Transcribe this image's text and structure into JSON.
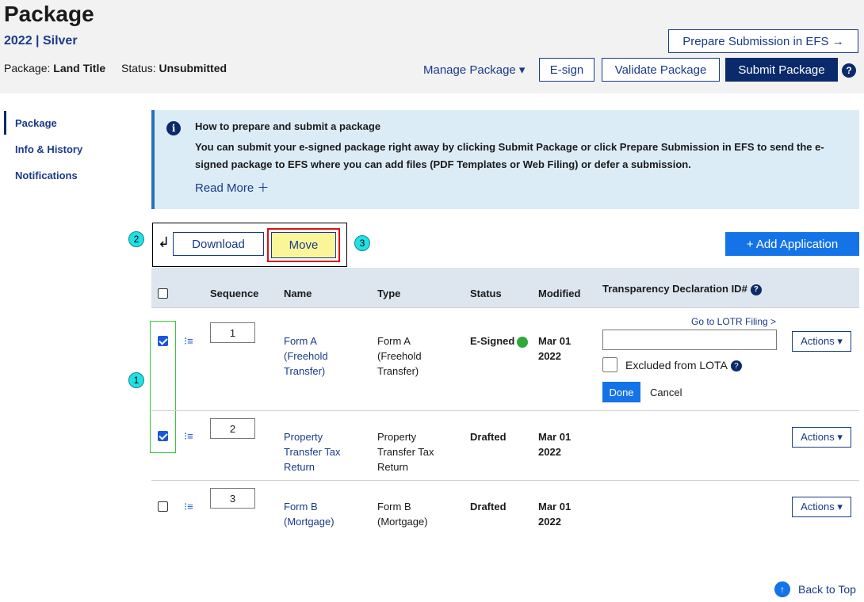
{
  "header": {
    "title": "Package",
    "subtitle": "2022 | Silver",
    "package_label": "Package:",
    "package_value": "Land Title",
    "status_label": "Status:",
    "status_value": "Unsubmitted",
    "prepare_efs": "Prepare Submission in EFS →",
    "manage_package": "Manage Package ▾",
    "esign": "E-sign",
    "validate": "Validate Package",
    "submit": "Submit Package",
    "help": "?"
  },
  "sidebar": {
    "items": [
      {
        "label": "Package",
        "active": true
      },
      {
        "label": "Info & History"
      },
      {
        "label": "Notifications"
      }
    ]
  },
  "info": {
    "icon": "i",
    "title": "How to prepare and submit a package",
    "body": "You can submit your e-signed package right away by clicking Submit Package or click Prepare Submission in EFS to send the e-signed package to EFS where you can add files (PDF Templates or Web Filing) or defer a submission.",
    "read_more": "Read More ＋"
  },
  "toolbar": {
    "download": "Download",
    "move": "Move",
    "add_application": "+ Add Application",
    "bulk_arrow": "↲"
  },
  "callouts": [
    "1",
    "2",
    "3"
  ],
  "table": {
    "headers": {
      "sequence": "Sequence",
      "name": "Name",
      "type": "Type",
      "status": "Status",
      "modified": "Modified",
      "tdid": "Transparency Declaration ID#",
      "tdid_help": "?"
    },
    "rows": [
      {
        "checked": true,
        "sequence": "1",
        "name": [
          "Form A",
          "(Freehold",
          "Transfer)"
        ],
        "type": [
          "Form A",
          "(Freehold",
          "Transfer)"
        ],
        "status": "E-Signed",
        "status_dot": "#2eaa3a",
        "modified": [
          "Mar 01",
          "2022"
        ],
        "actions": "Actions ▾"
      },
      {
        "checked": true,
        "sequence": "2",
        "name": [
          "Property",
          "Transfer Tax",
          "Return"
        ],
        "type": [
          "Property",
          "Transfer Tax",
          "Return"
        ],
        "status": "Drafted",
        "modified": [
          "Mar 01",
          "2022"
        ],
        "actions": "Actions ▾"
      },
      {
        "checked": false,
        "sequence": "3",
        "name": [
          "Form B",
          "(Mortgage)"
        ],
        "type": [
          "Form B",
          "(Mortgage)"
        ],
        "status": "Drafted",
        "modified": [
          "Mar 01",
          "2022"
        ],
        "actions": "Actions ▾"
      }
    ],
    "tdid_editor": {
      "lotr_link": "Go to LOTR Filing >",
      "input_value": "",
      "excluded_label": "Excluded from LOTA",
      "excluded_help": "?",
      "done": "Done",
      "cancel": "Cancel"
    },
    "reorder_icon": "reorder-icon"
  },
  "footer": {
    "back_to_top": "Back to Top",
    "back_icon": "↑"
  },
  "colors": {
    "navy": "#0b2a6b",
    "link": "#1a3a8a",
    "blue": "#1473e6",
    "info_bg": "#dcecf7",
    "callout": "#21e0e6",
    "move_highlight": "#fbf59a"
  }
}
